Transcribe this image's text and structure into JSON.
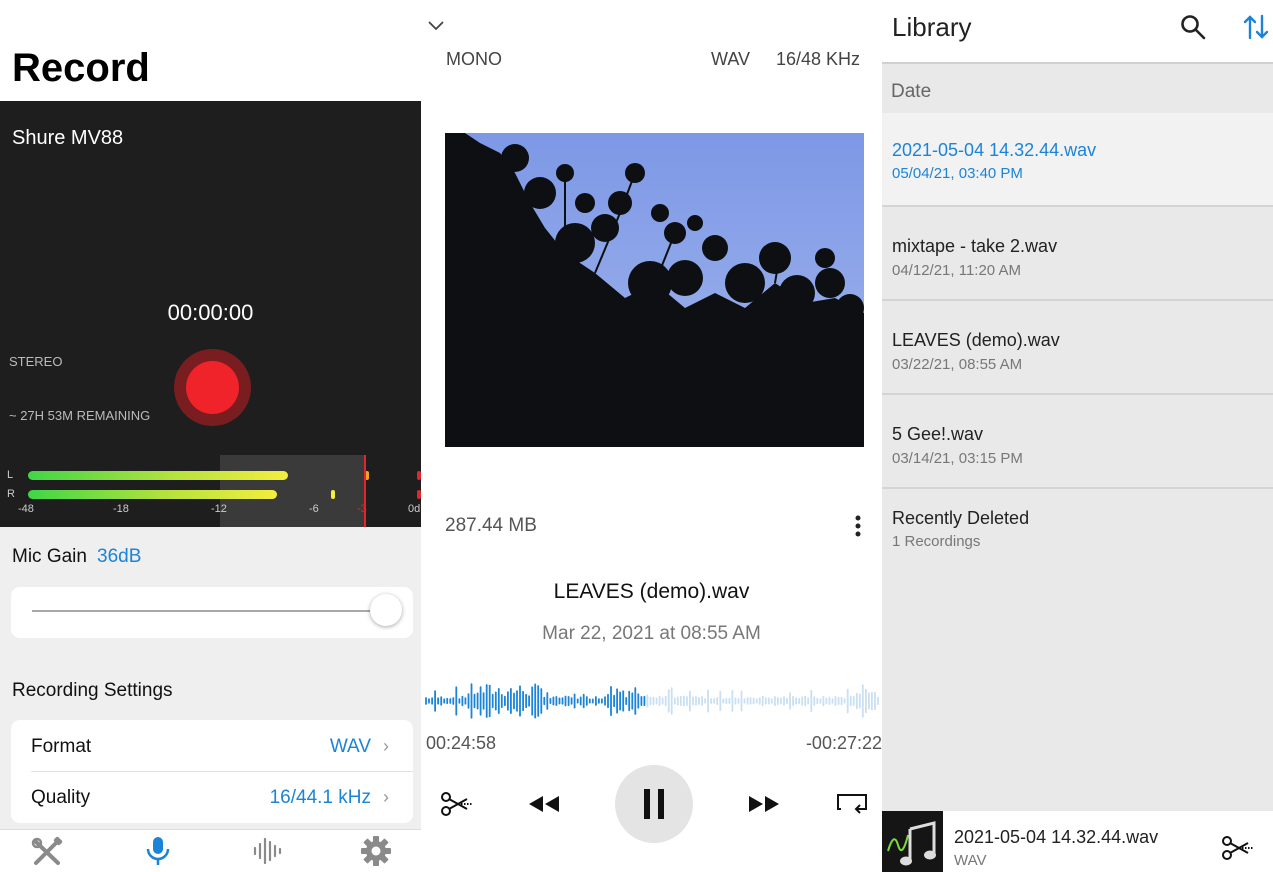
{
  "record": {
    "title": "Record",
    "device": "Shure MV88",
    "timer": "00:00:00",
    "channel_mode": "STEREO",
    "remaining": "~ 27H 53M REMAINING",
    "meter": {
      "left_label": "L",
      "right_label": "R",
      "ticks": [
        "-48",
        "-18",
        "-12",
        "-6",
        "-3",
        "0d"
      ],
      "left_level": 0.7,
      "right_level": 0.67
    },
    "mic_gain_label": "Mic Gain",
    "mic_gain_value": "36dB",
    "gain_slider_level": 1.0,
    "recording_settings_title": "Recording Settings",
    "format_label": "Format",
    "format_value": "WAV",
    "quality_label": "Quality",
    "quality_value": "16/44.1 kHz",
    "tabs": [
      {
        "icon": "tools-icon",
        "active": false
      },
      {
        "icon": "microphone-icon",
        "active": true
      },
      {
        "icon": "waveform-icon",
        "active": false
      },
      {
        "icon": "gear-icon",
        "active": false
      }
    ]
  },
  "player": {
    "channel": "MONO",
    "format": "WAV",
    "rate": "16/48 KHz",
    "file_size": "287.44 MB",
    "track_name": "LEAVES (demo).wav",
    "track_date": "Mar 22, 2021 at 08:55 AM",
    "elapsed": "00:24:58",
    "remaining": "-00:27:22",
    "progress": 0.48
  },
  "library": {
    "title": "Library",
    "section_header": "Date",
    "items": [
      {
        "name": "2021-05-04 14.32.44.wav",
        "date": "05/04/21, 03:40 PM",
        "selected": true
      },
      {
        "name": "mixtape - take 2.wav",
        "date": "04/12/21, 11:20 AM",
        "selected": false
      },
      {
        "name": "LEAVES (demo).wav",
        "date": "03/22/21, 08:55 AM",
        "selected": false
      },
      {
        "name": "5 Gee!.wav",
        "date": "03/14/21, 03:15 PM",
        "selected": false
      },
      {
        "name": "Recently Deleted",
        "date": "1 Recordings",
        "selected": false
      }
    ],
    "now_playing": {
      "name": "2021-05-04 14.32.44.wav",
      "format": "WAV"
    }
  },
  "colors": {
    "accent": "#1c84d6",
    "record_red": "#f0222a",
    "meter_green": "#3fd646",
    "meter_yellow": "#f4ee3e"
  }
}
